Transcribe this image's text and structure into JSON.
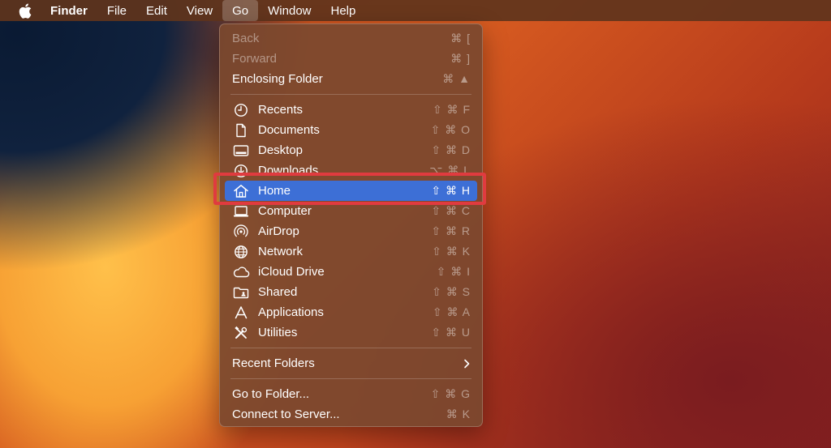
{
  "menubar": {
    "apple_icon": "apple-logo-icon",
    "items": [
      {
        "label": "Finder",
        "bold": true
      },
      {
        "label": "File"
      },
      {
        "label": "Edit"
      },
      {
        "label": "View"
      },
      {
        "label": "Go",
        "active": true
      },
      {
        "label": "Window"
      },
      {
        "label": "Help"
      }
    ]
  },
  "go_menu": {
    "back": {
      "label": "Back",
      "shortcut": "⌘ [",
      "enabled": false
    },
    "forward": {
      "label": "Forward",
      "shortcut": "⌘ ]",
      "enabled": false
    },
    "enclosing_folder": {
      "label": "Enclosing Folder",
      "shortcut": "⌘ ▲"
    },
    "places": [
      {
        "label": "Recents",
        "shortcut": "⇧ ⌘ F",
        "icon": "clock-icon"
      },
      {
        "label": "Documents",
        "shortcut": "⇧ ⌘ O",
        "icon": "document-icon"
      },
      {
        "label": "Desktop",
        "shortcut": "⇧ ⌘ D",
        "icon": "desktop-icon"
      },
      {
        "label": "Downloads",
        "shortcut": "⌥ ⌘ L",
        "icon": "download-icon"
      },
      {
        "label": "Home",
        "shortcut": "⇧ ⌘ H",
        "icon": "house-icon",
        "highlighted": true
      },
      {
        "label": "Computer",
        "shortcut": "⇧ ⌘ C",
        "icon": "laptop-icon"
      },
      {
        "label": "AirDrop",
        "shortcut": "⇧ ⌘ R",
        "icon": "airdrop-icon"
      },
      {
        "label": "Network",
        "shortcut": "⇧ ⌘ K",
        "icon": "globe-icon"
      },
      {
        "label": "iCloud Drive",
        "shortcut": "⇧ ⌘ I",
        "icon": "cloud-icon"
      },
      {
        "label": "Shared",
        "shortcut": "⇧ ⌘ S",
        "icon": "shared-folder-icon"
      },
      {
        "label": "Applications",
        "shortcut": "⇧ ⌘ A",
        "icon": "applications-icon"
      },
      {
        "label": "Utilities",
        "shortcut": "⇧ ⌘ U",
        "icon": "tools-icon"
      }
    ],
    "recent_folders": {
      "label": "Recent Folders",
      "icon": "chevron-right-icon"
    },
    "go_to_folder": {
      "label": "Go to Folder...",
      "shortcut": "⇧ ⌘ G"
    },
    "connect_to_server": {
      "label": "Connect to Server...",
      "shortcut": "⌘ K"
    }
  },
  "colors": {
    "highlight": "#3d6fd6",
    "callout": "#e03b3f",
    "menu_bg": "#7b482e"
  }
}
